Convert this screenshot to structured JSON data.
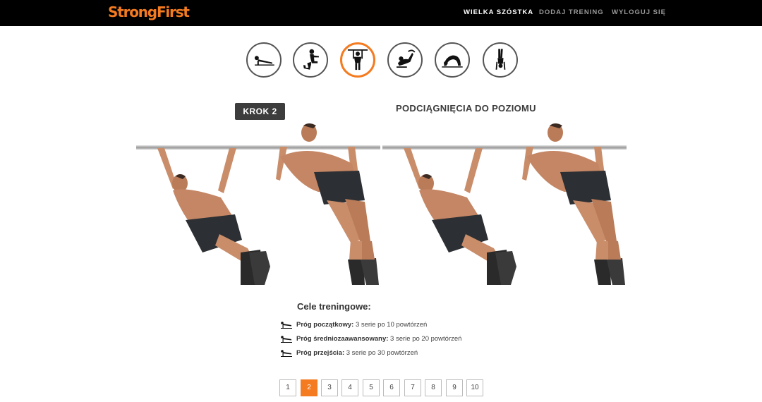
{
  "header": {
    "logo_strong": "Strong",
    "logo_first": "First",
    "nav": [
      "WIELKA SZÓSTKA",
      "DODAJ TRENING",
      "WYLOGUJ SIĘ"
    ]
  },
  "exercise_icons": [
    "pushup-icon",
    "squat-icon",
    "pullup-icon",
    "leg-raise-icon",
    "bridge-icon",
    "handstand-pushup-icon"
  ],
  "active_exercise_index": 2,
  "step": {
    "label": "KROK 2"
  },
  "exercise_title": "PODCIĄGNIĘCIA DO POZIOMU",
  "goals": {
    "title": "Cele treningowe:",
    "items": [
      {
        "label": "Próg początkowy:",
        "value": "3 serie po 10 powtórzeń"
      },
      {
        "label": "Próg średniozaawansowany:",
        "value": "3 serie po 20 powtórzeń"
      },
      {
        "label": "Próg przejścia:",
        "value": "3 serie po 30 powtórzeń"
      }
    ]
  },
  "pagination": {
    "pages": [
      "1",
      "2",
      "3",
      "4",
      "5",
      "6",
      "7",
      "8",
      "9",
      "10"
    ],
    "current": "2"
  },
  "colors": {
    "accent": "#f47b20",
    "topbar": "#000000",
    "badge": "#3d3d3d"
  }
}
